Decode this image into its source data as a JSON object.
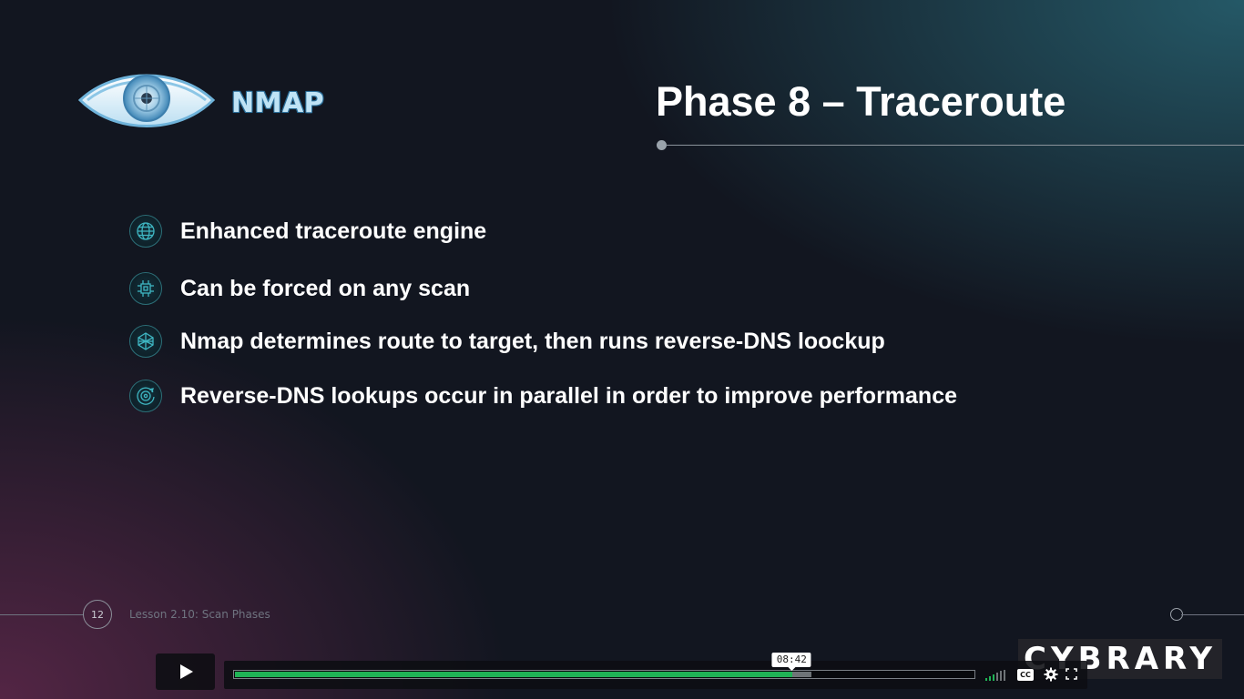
{
  "slide": {
    "logo_text": "NMAP",
    "title": "Phase 8 – Traceroute",
    "bullets": [
      {
        "icon": "globe-icon",
        "text": "Enhanced traceroute engine"
      },
      {
        "icon": "circuit-chip-icon",
        "text": "Can be forced on any scan"
      },
      {
        "icon": "network-mesh-icon",
        "text": "Nmap determines route to target, then runs reverse-DNS loockup"
      },
      {
        "icon": "radar-target-icon",
        "text": "Reverse-DNS lookups occur in parallel in order to improve performance"
      }
    ],
    "page_number": "12",
    "lesson": "Lesson 2.10: Scan Phases"
  },
  "brand": "CYBRARY",
  "player": {
    "current_time": "08:42",
    "played_fraction": 0.755,
    "buffered_fraction": 0.78,
    "cc_label": "CC"
  },
  "colors": {
    "accent_progress": "#20b356",
    "background": "#121620",
    "teal_glow": "#286473",
    "magenta_glow": "#5f284b",
    "icon_stroke": "#3fb6c2"
  }
}
